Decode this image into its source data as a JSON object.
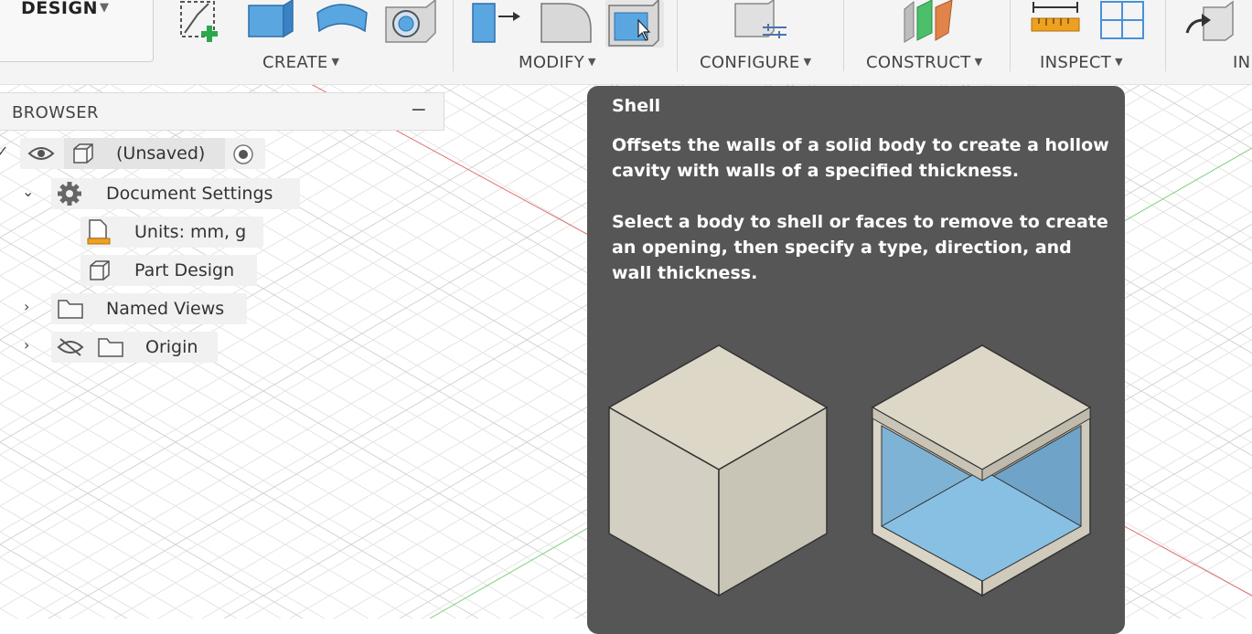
{
  "toolbar": {
    "workspace_label": "DESIGN",
    "groups": [
      {
        "label": "CREATE"
      },
      {
        "label": "MODIFY"
      },
      {
        "label": "CONFIGURE"
      },
      {
        "label": "CONSTRUCT"
      },
      {
        "label": "INSPECT"
      },
      {
        "label": "IN"
      }
    ]
  },
  "browser": {
    "title": "BROWSER",
    "collapse_symbol": "−",
    "items": [
      {
        "label": "(Unsaved)"
      },
      {
        "label": "Document Settings"
      },
      {
        "label": "Units: mm, g"
      },
      {
        "label": "Part Design"
      },
      {
        "label": "Named Views"
      },
      {
        "label": "Origin"
      }
    ]
  },
  "tooltip": {
    "title": "Shell",
    "paragraph1": "Offsets the walls of a solid body to create a hollow cavity with walls of a specified thickness.",
    "paragraph2": "Select a body to shell or faces to remove to create an opening, then specify a type, direction, and wall thickness."
  },
  "colors": {
    "tooltip_bg": "#565656",
    "toolbar_bg": "#f4f4f4",
    "axis_red": "#e05050",
    "axis_green": "#5ac85a",
    "accent_blue": "#4a90d9"
  }
}
